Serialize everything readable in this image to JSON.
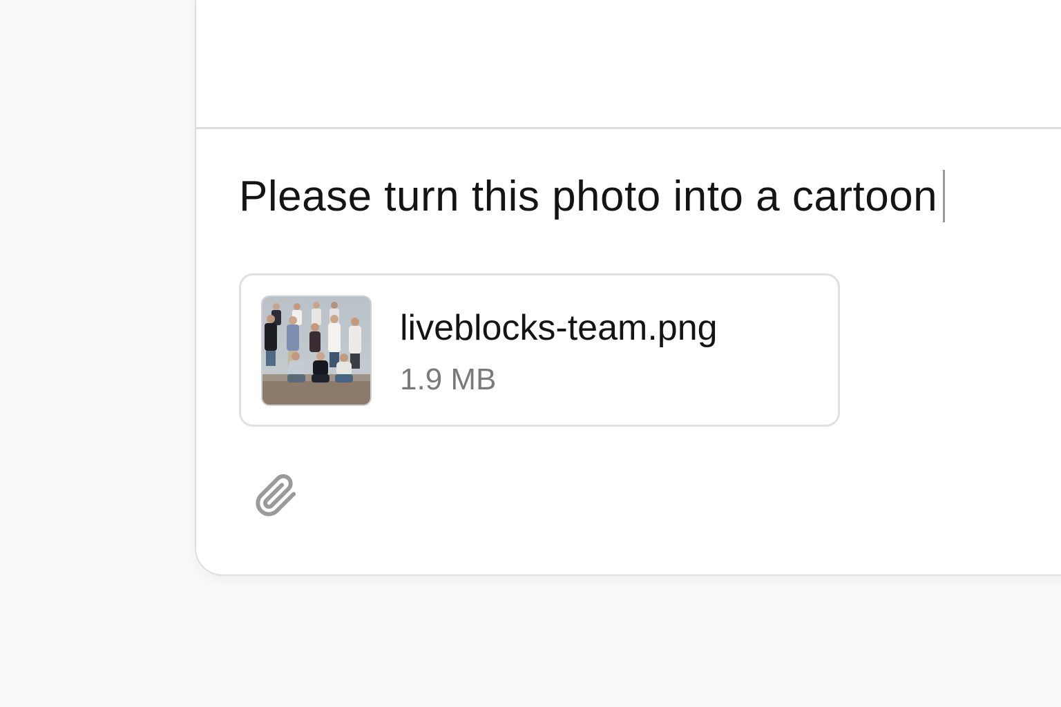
{
  "composer": {
    "text": "Please turn this photo into a cartoon"
  },
  "attachment": {
    "file_name": "liveblocks-team.png",
    "file_size": "1.9 MB",
    "thumbnail": "team-photo-thumbnail"
  },
  "toolbar": {
    "attach_icon": "paperclip-icon"
  },
  "colors": {
    "background": "#fafafa",
    "panel": "#ffffff",
    "border": "#dedede",
    "text": "#141414",
    "muted": "#7a7a7a",
    "icon": "#9a9a9a"
  }
}
